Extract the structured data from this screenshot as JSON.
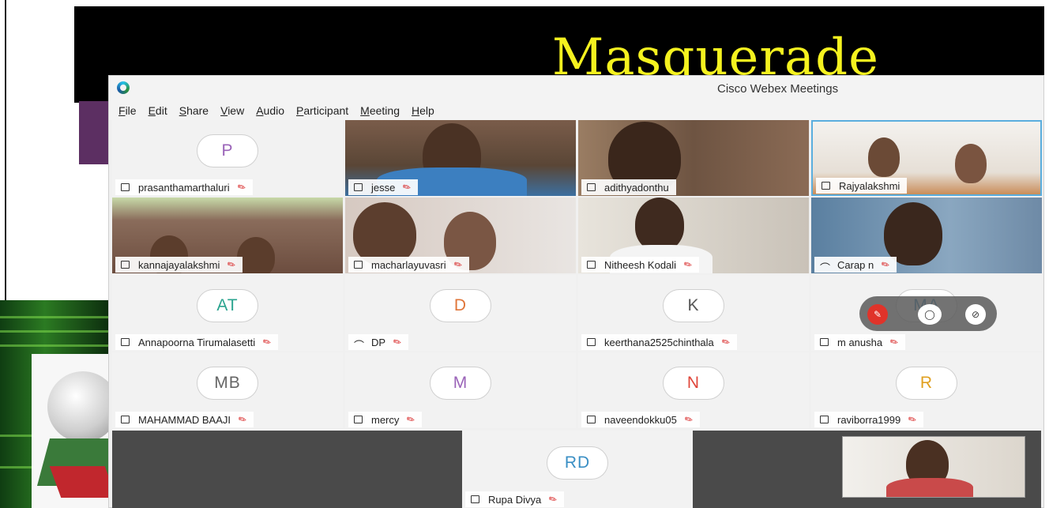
{
  "slide": {
    "title": "Masquerade"
  },
  "window": {
    "title": "Cisco Webex Meetings"
  },
  "menu": [
    {
      "label": "File",
      "hotkey": "F",
      "rest": "ile"
    },
    {
      "label": "Edit",
      "hotkey": "E",
      "rest": "dit"
    },
    {
      "label": "Share",
      "hotkey": "S",
      "rest": "hare"
    },
    {
      "label": "View",
      "hotkey": "V",
      "rest": "iew"
    },
    {
      "label": "Audio",
      "hotkey": "A",
      "rest": "udio"
    },
    {
      "label": "Participant",
      "hotkey": "P",
      "rest": "articipant"
    },
    {
      "label": "Meeting",
      "hotkey": "M",
      "rest": "eeting"
    },
    {
      "label": "Help",
      "hotkey": "H",
      "rest": "elp"
    }
  ],
  "participants": [
    {
      "name": "prasanthamarthaluri",
      "initials": "P",
      "initials_color": "#9a63b8",
      "muted": true,
      "video": false
    },
    {
      "name": "jesse",
      "muted": true,
      "video": true
    },
    {
      "name": "adithyadonthu",
      "muted": false,
      "video": true
    },
    {
      "name": "Rajyalakshmi",
      "muted": false,
      "video": true
    },
    {
      "name": "kannajayalakshmi",
      "muted": true,
      "video": true
    },
    {
      "name": "macharlayuvasri",
      "muted": true,
      "video": true
    },
    {
      "name": "Nitheesh Kodali",
      "muted": true,
      "video": true
    },
    {
      "name": "Carap n",
      "muted": true,
      "video": true,
      "audio_icon": true
    },
    {
      "name": "Annapoorna Tirumalasetti",
      "initials": "AT",
      "initials_color": "#2aa48f",
      "muted": true,
      "video": false
    },
    {
      "name": "DP",
      "initials": "D",
      "initials_color": "#e0763a",
      "muted": true,
      "video": false,
      "audio_icon": true
    },
    {
      "name": "keerthana2525chinthala",
      "initials": "K",
      "initials_color": "#555555",
      "muted": true,
      "video": false
    },
    {
      "name": "m anusha",
      "initials": "MA",
      "initials_color": "#3a8fc4",
      "muted": true,
      "video": false
    },
    {
      "name": "MAHAMMAD BAAJI",
      "initials": "MB",
      "initials_color": "#666666",
      "muted": true,
      "video": false
    },
    {
      "name": "mercy",
      "initials": "M",
      "initials_color": "#9a63b8",
      "muted": true,
      "video": false
    },
    {
      "name": "naveendokku05",
      "initials": "N",
      "initials_color": "#e0463a",
      "muted": true,
      "video": false
    },
    {
      "name": "raviborra1999",
      "initials": "R",
      "initials_color": "#e0a020",
      "muted": true,
      "video": false
    },
    {
      "name": "Rupa Divya",
      "initials": "RD",
      "initials_color": "#3a8fc4",
      "muted": true,
      "video": false
    }
  ],
  "icons": {
    "mute": "microphone-muted-icon",
    "tile": "video-square-icon",
    "audio": "headset-icon",
    "chat": "chat-icon",
    "stop": "stop-icon",
    "logo": "webex-logo-icon"
  },
  "colors": {
    "mute_red": "#e0332a",
    "slide_yellow": "#f5f21f"
  }
}
